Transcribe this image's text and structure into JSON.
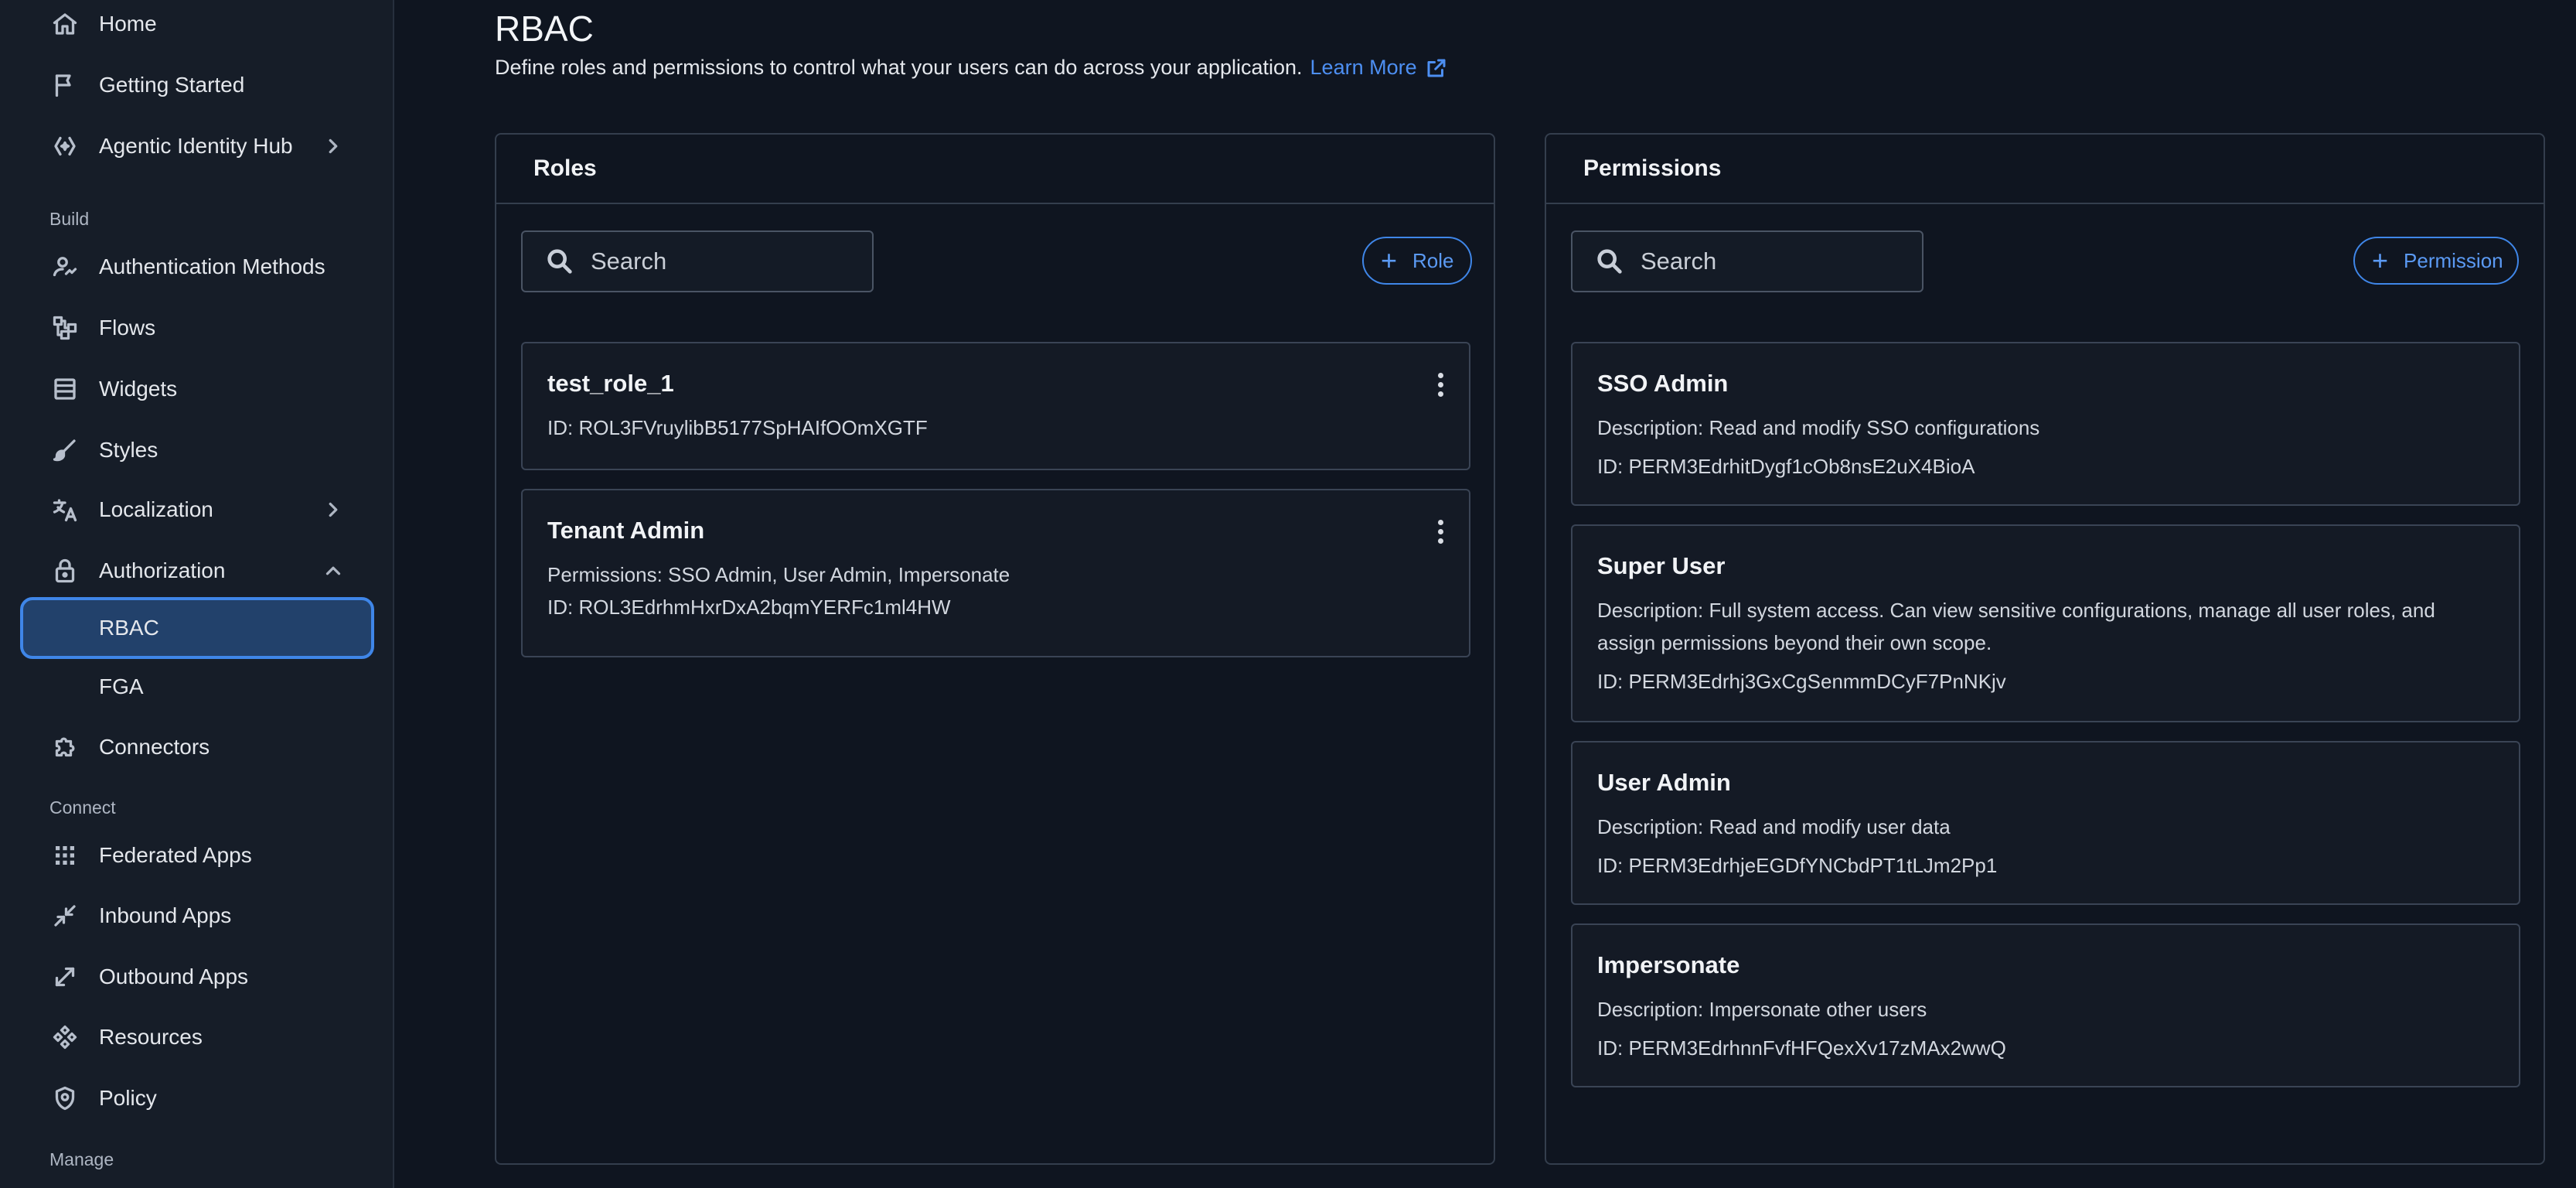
{
  "sidebar": {
    "items": [
      {
        "label": "Home",
        "icon": "home-icon"
      },
      {
        "label": "Getting Started",
        "icon": "flag-icon"
      },
      {
        "label": "Agentic Identity Hub",
        "icon": "hub-icon"
      },
      {
        "label": "Authentication Methods",
        "icon": "signature-icon"
      },
      {
        "label": "Flows",
        "icon": "flow-icon"
      },
      {
        "label": "Widgets",
        "icon": "widgets-icon"
      },
      {
        "label": "Styles",
        "icon": "brush-icon"
      },
      {
        "label": "Localization",
        "icon": "translate-icon"
      },
      {
        "label": "Authorization",
        "icon": "lock-icon"
      },
      {
        "label": "Connectors",
        "icon": "puzzle-icon"
      },
      {
        "label": "Federated Apps",
        "icon": "grid-icon"
      },
      {
        "label": "Inbound Apps",
        "icon": "inbound-arrow-icon"
      },
      {
        "label": "Outbound Apps",
        "icon": "outbound-arrow-icon"
      },
      {
        "label": "Resources",
        "icon": "resources-icon"
      },
      {
        "label": "Policy",
        "icon": "shield-icon"
      }
    ],
    "sub_items": [
      {
        "label": "RBAC",
        "active": true
      },
      {
        "label": "FGA",
        "active": false
      }
    ],
    "sections": {
      "build": "Build",
      "connect": "Connect",
      "manage": "Manage"
    }
  },
  "page": {
    "title": "RBAC",
    "description": "Define roles and permissions to control what your users can do across your application.",
    "learn_more": "Learn More"
  },
  "roles": {
    "header": "Roles",
    "search_placeholder": "Search",
    "add_label": "Role",
    "items": [
      {
        "name": "test_role_1",
        "id": "ID: ROL3FVruylibB5177SpHAIfOOmXGTF"
      },
      {
        "name": "Tenant Admin",
        "permissions": "Permissions: SSO Admin, User Admin, Impersonate",
        "id": "ID: ROL3EdrhmHxrDxA2bqmYERFc1ml4HW"
      }
    ]
  },
  "permissions": {
    "header": "Permissions",
    "search_placeholder": "Search",
    "add_label": "Permission",
    "items": [
      {
        "name": "SSO Admin",
        "description": "Description: Read and modify SSO configurations",
        "id": "ID: PERM3EdrhitDygf1cOb8nsE2uX4BioA"
      },
      {
        "name": "Super User",
        "description_line1": "Description: Full system access. Can view sensitive configurations, manage all user roles, and",
        "description_line2": "assign permissions beyond their own scope.",
        "id": "ID: PERM3Edrhj3GxCgSenmmDCyF7PnNKjv"
      },
      {
        "name": "User Admin",
        "description": "Description: Read and modify user data",
        "id": "ID: PERM3EdrhjeEGDfYNCbdPT1tLJm2Pp1"
      },
      {
        "name": "Impersonate",
        "description": "Description: Impersonate other users",
        "id": "ID: PERM3EdrhnnFvfHFQexXv17zMAx2wwQ"
      }
    ]
  },
  "colors": {
    "accent": "#3f86e8",
    "background": "#0f1520",
    "sidebar": "#161d28",
    "active_item": "#22416b"
  }
}
